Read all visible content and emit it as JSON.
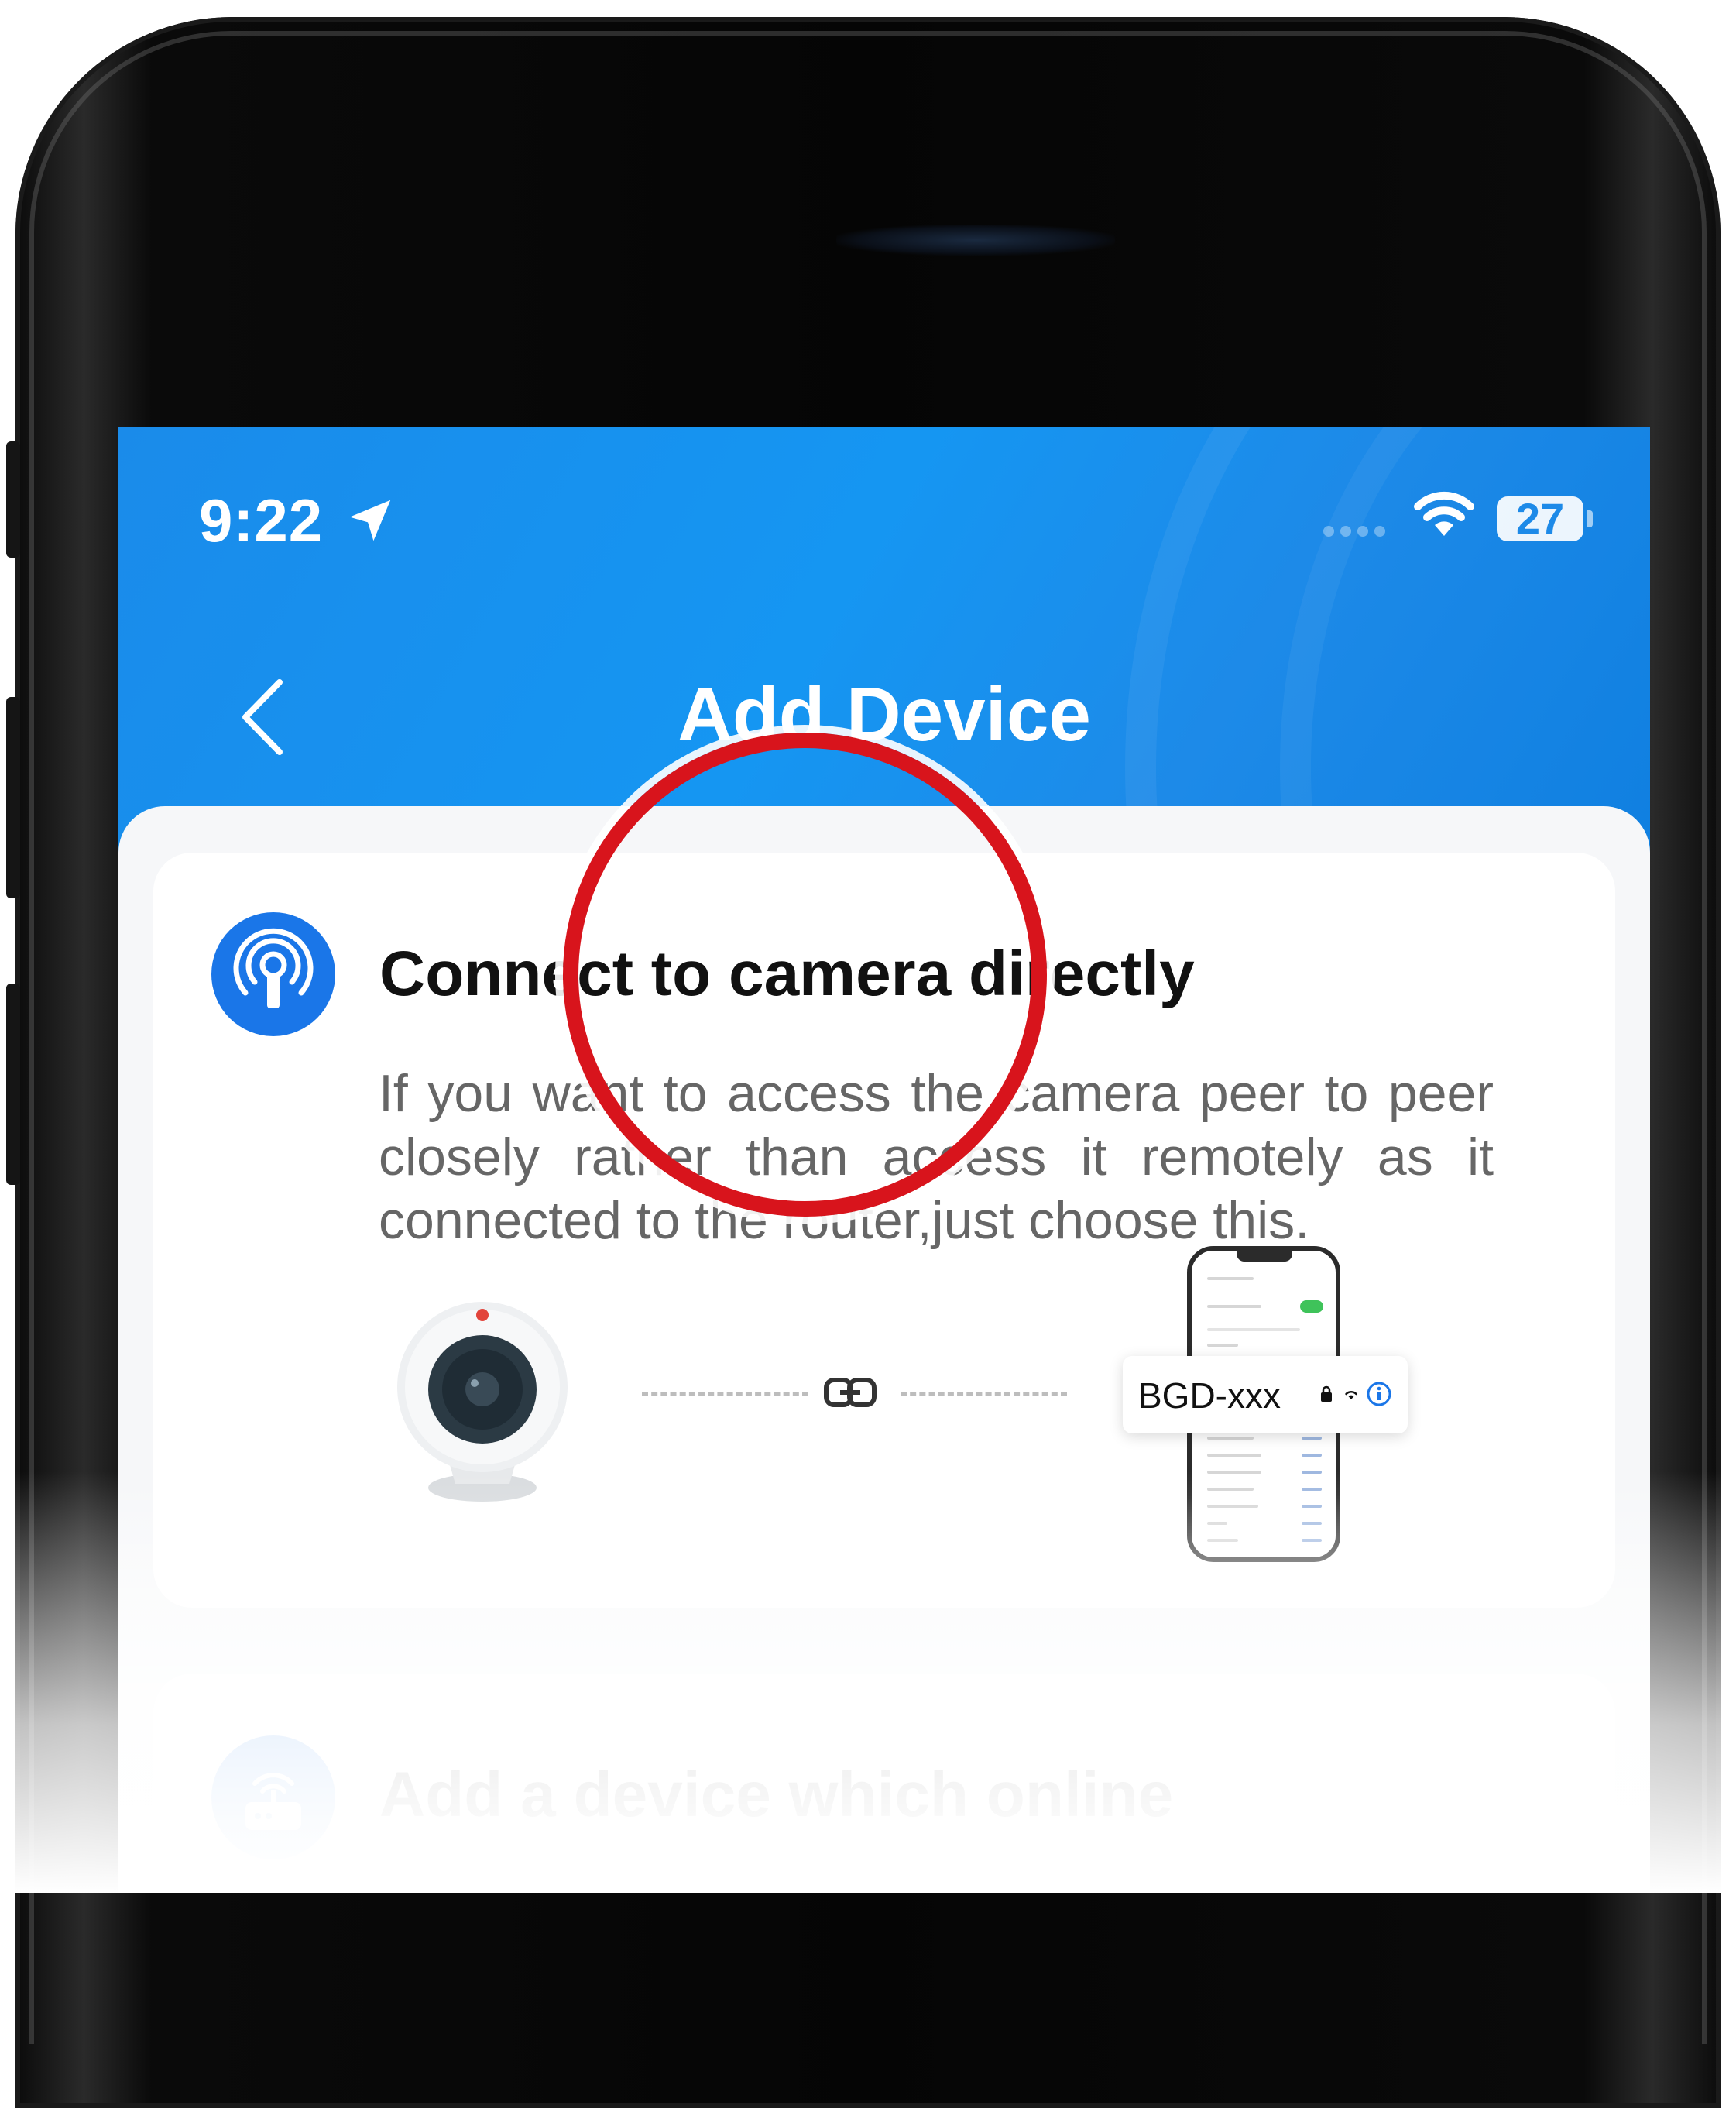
{
  "status_bar": {
    "time": "9:22",
    "battery": "27"
  },
  "nav": {
    "title": "Add Device"
  },
  "options": [
    {
      "title": "Connect to camera directly",
      "description": "If you want to access the camera peer to peer closely rather than access it remotely as it connected to the router,just choose this.",
      "icon": "hotspot-icon",
      "illustration": {
        "network_name": "BGD-xxx"
      }
    },
    {
      "title": "Add a device which online",
      "icon": "router-icon"
    }
  ],
  "colors": {
    "header_blue": "#1596f2",
    "icon_blue": "#1a76e8",
    "annotation_red": "#d8141c"
  }
}
